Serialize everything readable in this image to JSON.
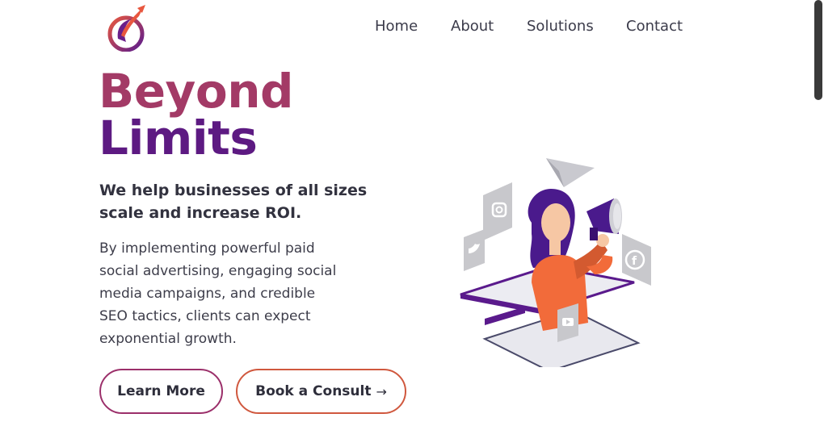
{
  "header": {
    "logo_icon": "brand-swirl-rocket-icon",
    "nav": {
      "home": "Home",
      "about": "About",
      "solutions": "Solutions",
      "contact": "Contact"
    }
  },
  "hero": {
    "title_line1": "Beyond",
    "title_line2": "Limits",
    "subheading": "We help businesses of all sizes scale and increase ROI.",
    "body": "By implementing powerful paid social advertising, engaging social media campaigns, and credible SEO tactics, clients can expect exponential growth.",
    "buttons": {
      "learn_more": "Learn More",
      "book_consult": "Book a Consult",
      "book_consult_arrow": "→"
    }
  },
  "illustration": {
    "icons": [
      "paper-plane-icon",
      "instagram-icon",
      "twitter-icon",
      "facebook-icon",
      "youtube-icon",
      "megaphone-icon"
    ]
  },
  "colors": {
    "title_top": "#a33a66",
    "title_bottom": "#5d1a82",
    "accent_purple": "#5a1a8c",
    "accent_orange": "#f26b3a"
  }
}
